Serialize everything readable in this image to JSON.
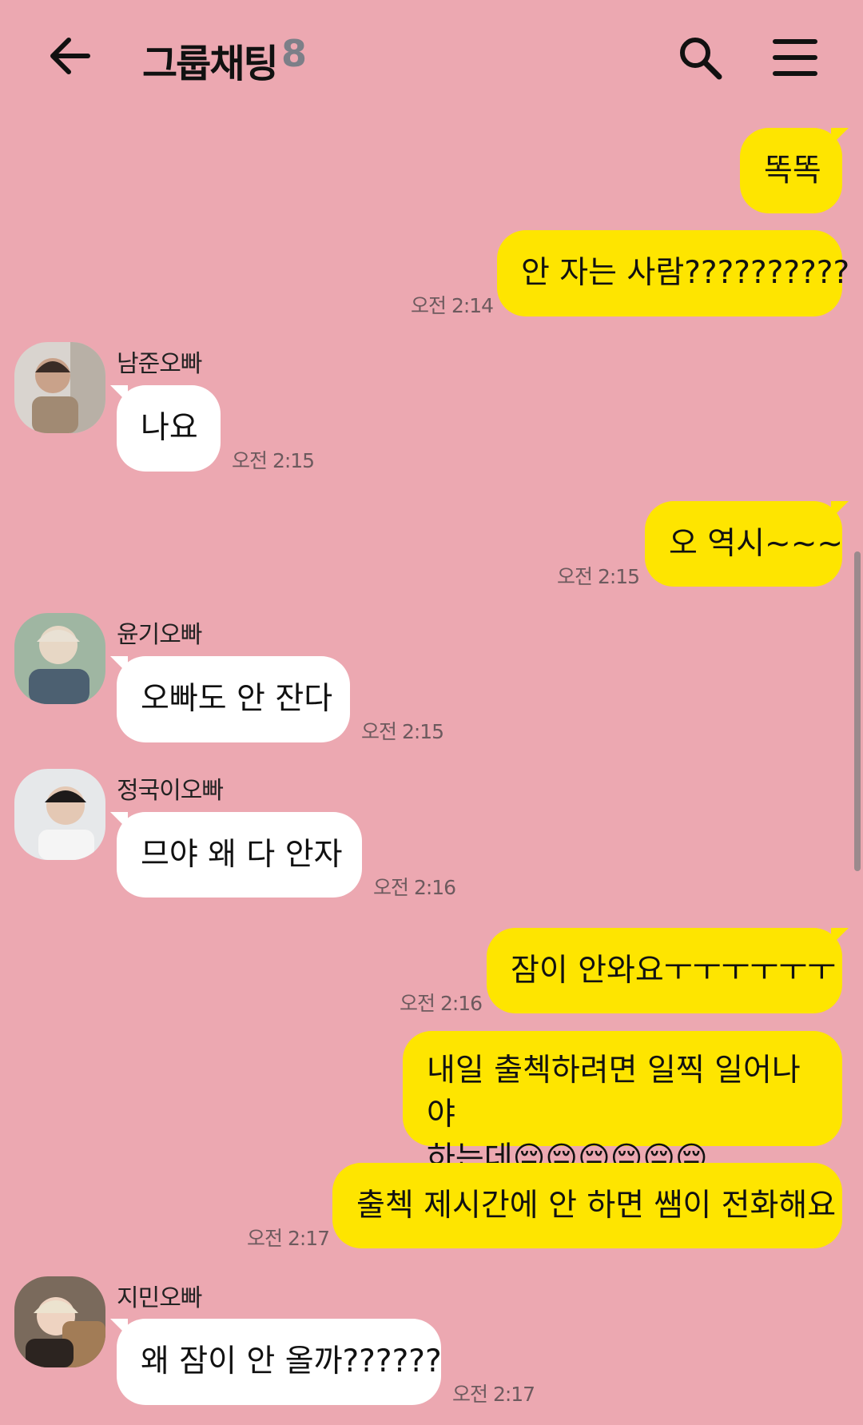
{
  "header": {
    "title": "그룹채팅",
    "member_count": "8"
  },
  "messages": [
    {
      "type": "me",
      "text": "똑똑"
    },
    {
      "type": "me",
      "text": "안 자는 사람??????????",
      "time": "오전 2:14"
    },
    {
      "type": "them",
      "sender": "남준오빠",
      "text": "나요",
      "time": "오전 2:15"
    },
    {
      "type": "me",
      "text": "오 역시~~~",
      "time": "오전 2:15"
    },
    {
      "type": "them",
      "sender": "윤기오빠",
      "text": "오빠도 안 잔다",
      "time": "오전 2:15"
    },
    {
      "type": "them",
      "sender": "정국이오빠",
      "text": "므야 왜 다 안자",
      "time": "오전 2:16"
    },
    {
      "type": "me",
      "text": "잠이 안와요ㅜㅜㅜㅜㅜㅜ",
      "time": "오전 2:16"
    },
    {
      "type": "me",
      "text_line1": "내일 출첵하려면 일찍 일어나야",
      "text_line2": "하는데😔😔😔😔😔😔"
    },
    {
      "type": "me",
      "text": "출첵 제시간에 안 하면 쌤이 전화해요",
      "time": "오전 2:17"
    },
    {
      "type": "them",
      "sender": "지민오빠",
      "text": "왜 잠이 안 올까??????",
      "time": "오전 2:17"
    }
  ],
  "colors": {
    "background": "#eca8b1",
    "my_bubble": "#fee500",
    "their_bubble": "#ffffff"
  }
}
